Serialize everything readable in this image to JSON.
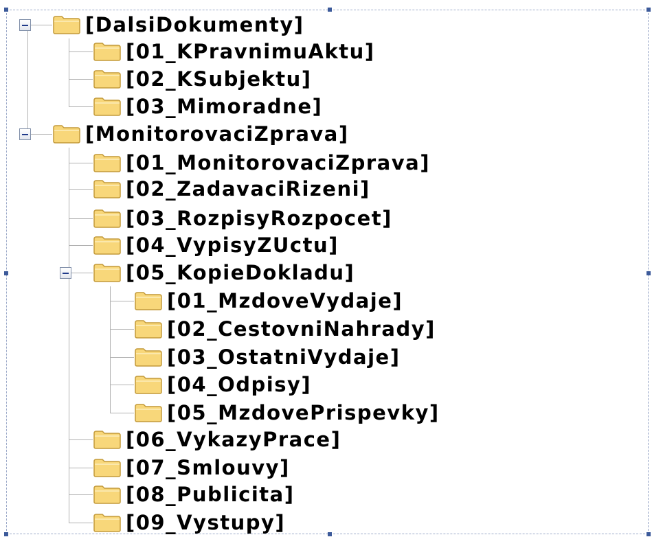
{
  "tree": {
    "nodes": [
      {
        "label": "[DalsiDokumenty]",
        "expanded": true
      },
      {
        "label": "[01_KPravnimuAktu]"
      },
      {
        "label": "[02_KSubjektu]"
      },
      {
        "label": "[03_Mimoradne]"
      },
      {
        "label": "[MonitorovaciZprava]",
        "expanded": true
      },
      {
        "label": "[01_MonitorovaciZprava]"
      },
      {
        "label": "[02_ZadavaciRizeni]"
      },
      {
        "label": "[03_RozpisyRozpocet]"
      },
      {
        "label": "[04_VypisyZUctu]"
      },
      {
        "label": "[05_KopieDokladu]",
        "expanded": true
      },
      {
        "label": "[01_MzdoveVydaje]"
      },
      {
        "label": "[02_CestovniNahrady]"
      },
      {
        "label": "[03_OstatniVydaje]"
      },
      {
        "label": "[04_Odpisy]"
      },
      {
        "label": "[05_MzdovePrispevky]"
      },
      {
        "label": "[06_VykazyPrace]"
      },
      {
        "label": "[07_Smlouvy]"
      },
      {
        "label": "[08_Publicita]"
      },
      {
        "label": "[09_Vystupy]"
      }
    ]
  },
  "colors": {
    "folder_fill": "#f8d77a",
    "folder_edge": "#c39a3a",
    "tree_line": "#b0b0b0",
    "selection_frame": "#9aa8c8"
  },
  "icons": {
    "folder": "folder-icon",
    "collapse": "collapse-minus-icon"
  }
}
